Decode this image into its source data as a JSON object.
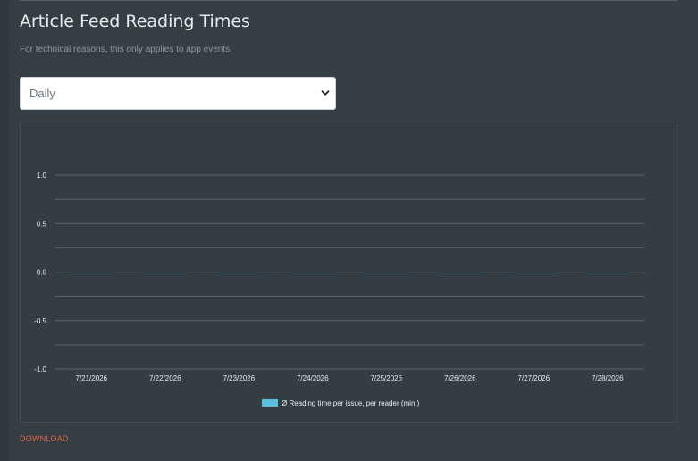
{
  "header": {
    "title": "Article Feed Reading Times",
    "subtitle": "For technical reasons, this only applies to app events."
  },
  "period_select": {
    "value": "Daily",
    "icon": "chevron-down-icon"
  },
  "download_label": "DOWNLOAD",
  "colors": {
    "series": "#5bc0de",
    "link": "#e0663f",
    "grid": "#5a646d",
    "text": "#e9ecef"
  },
  "chart_data": {
    "type": "bar",
    "categories": [
      "7/21/2026",
      "7/22/2026",
      "7/23/2026",
      "7/24/2026",
      "7/25/2026",
      "7/26/2026",
      "7/27/2026",
      "7/28/2026"
    ],
    "series": [
      {
        "name": "Ø Reading time per issue, per reader (min.)",
        "values": [
          0,
          0,
          0,
          0,
          0,
          0,
          0,
          0
        ]
      }
    ],
    "yticks": [
      "1.0",
      "0.5",
      "0.0",
      "-0.5",
      "-1.0"
    ],
    "ylim": [
      -1.0,
      1.0
    ],
    "grid": true,
    "legend_position": "bottom"
  }
}
